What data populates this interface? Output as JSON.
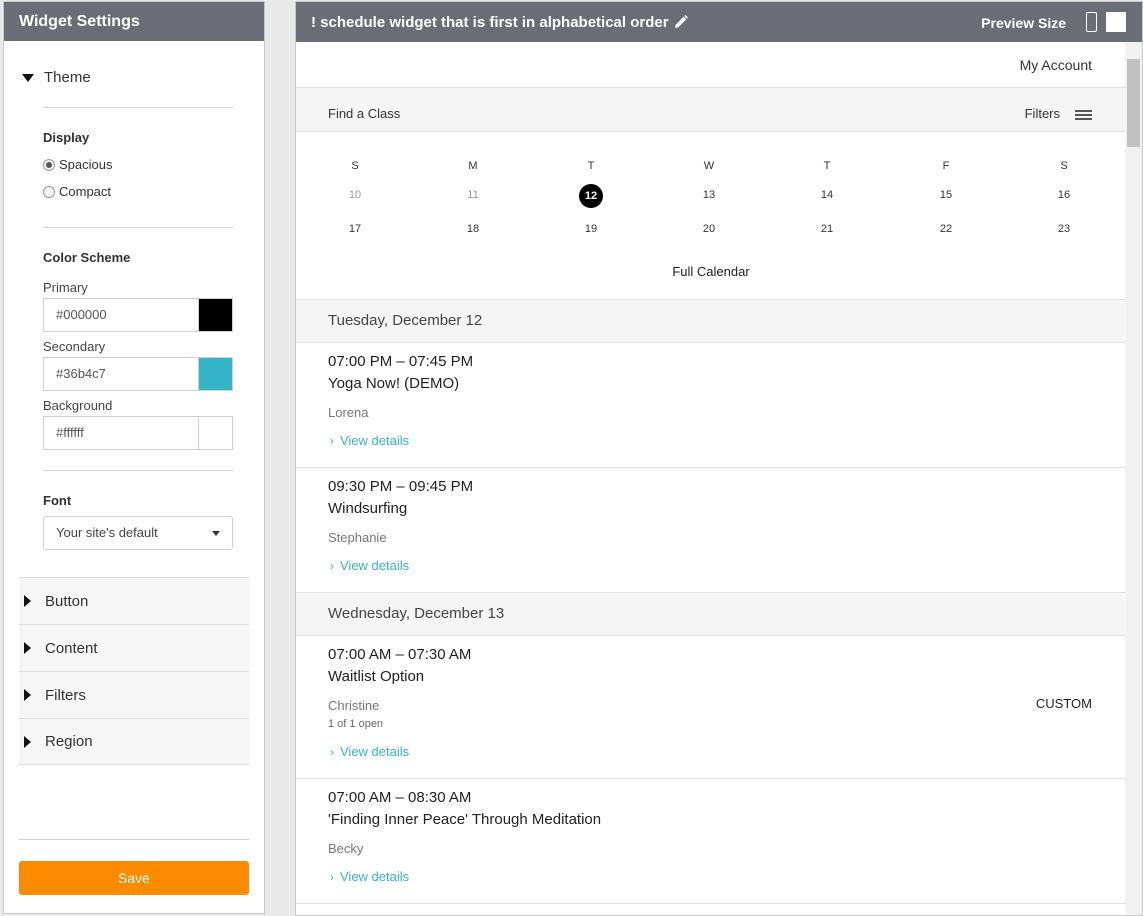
{
  "left_panel": {
    "title": "Widget Settings",
    "theme_label": "Theme",
    "display_label": "Display",
    "display_options": [
      "Spacious",
      "Compact"
    ],
    "display_selected": "Spacious",
    "color_scheme_label": "Color Scheme",
    "primary_label": "Primary",
    "primary_value": "#000000",
    "secondary_label": "Secondary",
    "secondary_value": "#36b4c7",
    "background_label": "Background",
    "background_value": "#ffffff",
    "font_label": "Font",
    "font_value": "Your site's default",
    "sections": [
      "Button",
      "Content",
      "Filters",
      "Region"
    ],
    "save_label": "Save"
  },
  "preview": {
    "title": "! schedule widget that is first in alphabetical order",
    "preview_size_label": "Preview Size",
    "account_link": "My Account",
    "find_label": "Find a Class",
    "filters_label": "Filters",
    "weekdays": [
      "S",
      "M",
      "T",
      "W",
      "T",
      "F",
      "S"
    ],
    "week1": [
      "10",
      "11",
      "12",
      "13",
      "14",
      "15",
      "16"
    ],
    "week2": [
      "17",
      "18",
      "19",
      "20",
      "21",
      "22",
      "23"
    ],
    "full_calendar_label": "Full Calendar",
    "days": [
      {
        "heading": "Tuesday, December 12",
        "sessions": [
          {
            "time": "07:00 PM – 07:45 PM",
            "name": "Yoga Now! (DEMO)",
            "staff": "Lorena",
            "details": "View details"
          },
          {
            "time": "09:30 PM – 09:45 PM",
            "name": "Windsurfing",
            "staff": "Stephanie",
            "details": "View details"
          }
        ]
      },
      {
        "heading": "Wednesday, December 13",
        "sessions": [
          {
            "time": "07:00 AM – 07:30 AM",
            "name": "Waitlist Option",
            "staff": "Christine",
            "availability": "1 of 1 open",
            "badge": "CUSTOM",
            "details": "View details"
          },
          {
            "time": "07:00 AM – 08:30 AM",
            "name": "'Finding Inner Peace' Through Meditation",
            "staff": "Becky",
            "details": "View details"
          }
        ]
      }
    ]
  },
  "colors": {
    "header_bg": "#6b6d76",
    "accent": "#36b4c7",
    "save_button": "#fb8c00"
  }
}
